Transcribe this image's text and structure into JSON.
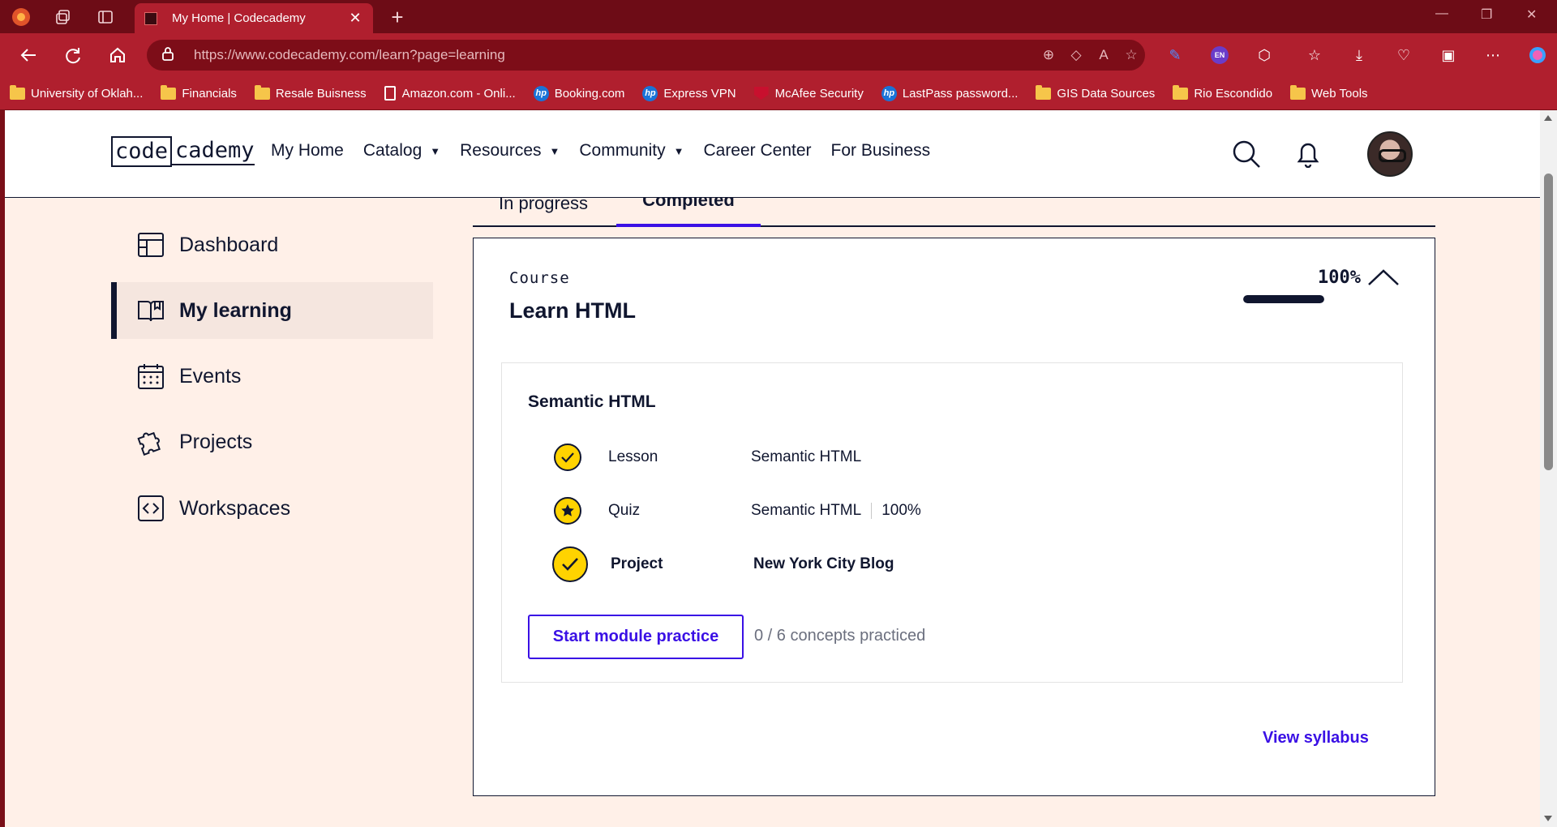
{
  "browser": {
    "tab_title": "My Home | Codecademy",
    "url": "https://www.codecademy.com/learn?page=learning",
    "bookmarks": [
      {
        "label": "University of Oklah...",
        "icon": "folder-icon"
      },
      {
        "label": "Financials",
        "icon": "folder-icon"
      },
      {
        "label": "Resale Buisness",
        "icon": "folder-icon"
      },
      {
        "label": "Amazon.com - Onli...",
        "icon": "page-icon"
      },
      {
        "label": "Booking.com",
        "icon": "hp-icon"
      },
      {
        "label": "Express VPN",
        "icon": "hp-icon"
      },
      {
        "label": "McAfee Security",
        "icon": "mcafee-icon"
      },
      {
        "label": "LastPass password...",
        "icon": "hp-icon"
      },
      {
        "label": "GIS Data Sources",
        "icon": "folder-icon"
      },
      {
        "label": "Rio Escondido",
        "icon": "folder-icon"
      },
      {
        "label": "Web Tools",
        "icon": "folder-icon"
      }
    ],
    "profile_badge": "EN",
    "accent_color": "#b01f2e"
  },
  "site": {
    "logo_box": "code",
    "logo_rest": "cademy",
    "nav": {
      "my_home": "My Home",
      "catalog": "Catalog",
      "resources": "Resources",
      "community": "Community",
      "career_center": "Career Center",
      "for_business": "For Business"
    }
  },
  "sidebar": {
    "items": [
      {
        "label": "Dashboard",
        "icon": "dashboard-icon"
      },
      {
        "label": "My learning",
        "icon": "book-icon"
      },
      {
        "label": "Events",
        "icon": "calendar-icon"
      },
      {
        "label": "Projects",
        "icon": "puzzle-icon"
      },
      {
        "label": "Workspaces",
        "icon": "code-brackets-icon"
      }
    ],
    "active_index": 1
  },
  "main": {
    "tabs": [
      "In progress",
      "Completed"
    ],
    "active_tab": "Completed",
    "course": {
      "type": "Course",
      "title": "Learn HTML",
      "percent": "100%",
      "progress_fraction": 1.0,
      "module": {
        "title": "Semantic HTML",
        "items": [
          {
            "kind": "Lesson",
            "name": "Semantic HTML",
            "score": "",
            "icon": "check-icon"
          },
          {
            "kind": "Quiz",
            "name": "Semantic HTML",
            "score": "100%",
            "icon": "star-icon"
          },
          {
            "kind": "Project",
            "name": "New York City Blog",
            "score": "",
            "icon": "check-icon"
          }
        ],
        "practice_button": "Start module practice",
        "concepts": "0 / 6 concepts practiced"
      },
      "syllabus_link": "View syllabus"
    }
  },
  "colors": {
    "navy": "#10162f",
    "brand_purple": "#3a10e5",
    "badge_yellow": "#ffd300",
    "page_bg": "#fff0e8"
  }
}
